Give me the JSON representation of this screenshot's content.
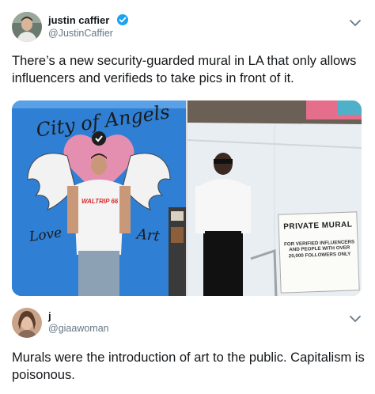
{
  "tweet1": {
    "name": "justin caffier",
    "handle": "@JustinCaffier",
    "text": "There’s a new security-guarded mural in LA that only allows influencers and verifieds to take pics in front of it.",
    "media": {
      "mural_title": "City of Angels",
      "mural_love": "Love",
      "mural_art": "Art",
      "shirt_text": "WALTRIP 66",
      "sign_title": "PRIVATE MURAL",
      "sign_body": "FOR VERIFIED INFLUENCERS AND PEOPLE WITH OVER 20,000 FOLLOWERS ONLY"
    }
  },
  "tweet2": {
    "name": "j",
    "handle": "@giaawoman",
    "text": "Murals were the introduction of art to the public. Capitalism is poisonous."
  },
  "colors": {
    "verified": "#1da1f2",
    "handle": "#657786",
    "text": "#14171a",
    "mural_blue": "#2f7fd4",
    "heart_pink": "#e58fb0"
  },
  "icons": [
    "verified-badge-icon",
    "chevron-down-icon"
  ]
}
